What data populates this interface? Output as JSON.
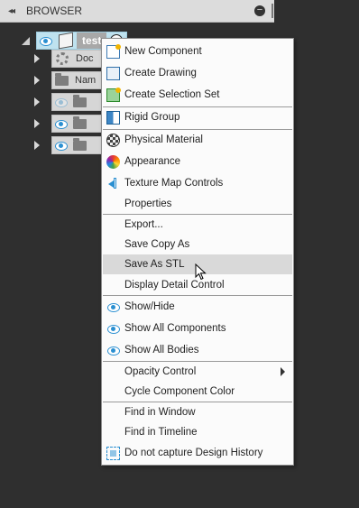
{
  "browser": {
    "collapse_glyph": "◂◂",
    "title": "BROWSER",
    "minus_glyph": "−"
  },
  "tree": {
    "root_label": "test",
    "items": [
      {
        "label": "Doc",
        "icon": "gear-icon",
        "visible": null
      },
      {
        "label": "Nam",
        "icon": "folder-icon",
        "visible": null
      },
      {
        "label": "",
        "icon": "folder-icon",
        "visible": false
      },
      {
        "label": "",
        "icon": "folder-icon",
        "visible": true
      },
      {
        "label": "",
        "icon": "folder-icon",
        "visible": true
      }
    ]
  },
  "menu": {
    "items": {
      "new_component": "New Component",
      "create_drawing": "Create Drawing",
      "create_selection_set": "Create Selection Set",
      "rigid_group": "Rigid Group",
      "physical_material": "Physical Material",
      "appearance": "Appearance",
      "texture_map_controls": "Texture Map Controls",
      "properties": "Properties",
      "export": "Export...",
      "save_copy_as": "Save Copy As",
      "save_as_stl": "Save As STL",
      "display_detail_control": "Display Detail Control",
      "show_hide": "Show/Hide",
      "show_all_components": "Show All Components",
      "show_all_bodies": "Show All Bodies",
      "opacity_control": "Opacity Control",
      "cycle_component_color": "Cycle Component Color",
      "find_in_window": "Find in Window",
      "find_in_timeline": "Find in Timeline",
      "do_not_capture_history": "Do not capture Design History"
    },
    "highlighted": "Save As STL"
  },
  "colors": {
    "accent": "#2a8fd1",
    "background": "#2f2f2f",
    "menu_bg": "#fbfbfb",
    "highlight": "#d9d9d9"
  }
}
